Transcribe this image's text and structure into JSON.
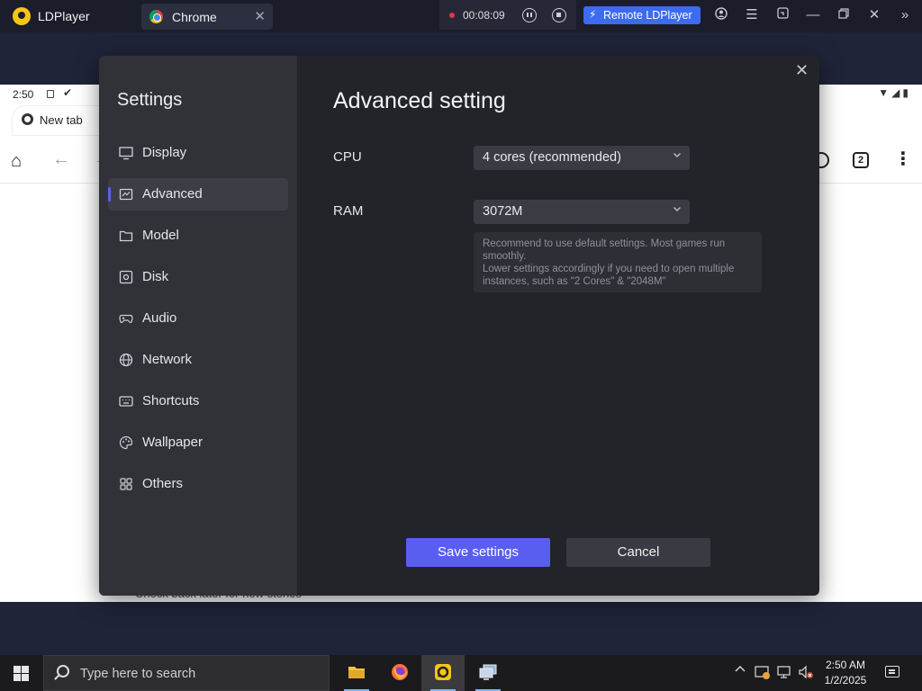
{
  "titlebar": {
    "app_name": "LDPlayer",
    "tab_label": "Chrome",
    "tab_close": "✕",
    "record_time": "00:08:09",
    "remote_label": "Remote LDPlayer"
  },
  "android": {
    "time": "2:50",
    "tab_label": "New tab",
    "tab_count": "2",
    "bottom_text": "Check back later for new stories"
  },
  "settings": {
    "sidebar_title": "Settings",
    "nav": [
      {
        "label": "Display",
        "icon": "monitor-icon"
      },
      {
        "label": "Advanced",
        "icon": "chip-icon",
        "active": true
      },
      {
        "label": "Model",
        "icon": "folder-icon"
      },
      {
        "label": "Disk",
        "icon": "disk-icon"
      },
      {
        "label": "Audio",
        "icon": "gamepad-icon"
      },
      {
        "label": "Network",
        "icon": "globe-icon"
      },
      {
        "label": "Shortcuts",
        "icon": "keyboard-icon"
      },
      {
        "label": "Wallpaper",
        "icon": "palette-icon"
      },
      {
        "label": "Others",
        "icon": "grid-icon"
      }
    ],
    "heading": "Advanced setting",
    "cpu_label": "CPU",
    "cpu_value": "4 cores (recommended)",
    "ram_label": "RAM",
    "ram_value": "3072M",
    "hint_line1": "Recommend to use default settings. Most games run smoothly.",
    "hint_line2": "Lower settings accordingly if you need to open multiple instances, such as \"2 Cores\" & \"2048M\"",
    "save_label": "Save settings",
    "cancel_label": "Cancel"
  },
  "taskbar": {
    "search_placeholder": "Type here to search",
    "clock_time": "2:50 AM",
    "clock_date": "1/2/2025"
  },
  "colors": {
    "accent": "#5a5ef0",
    "remote_button": "#3d6bf0",
    "dialog_bg": "#232429",
    "sidebar_bg": "#313238"
  }
}
